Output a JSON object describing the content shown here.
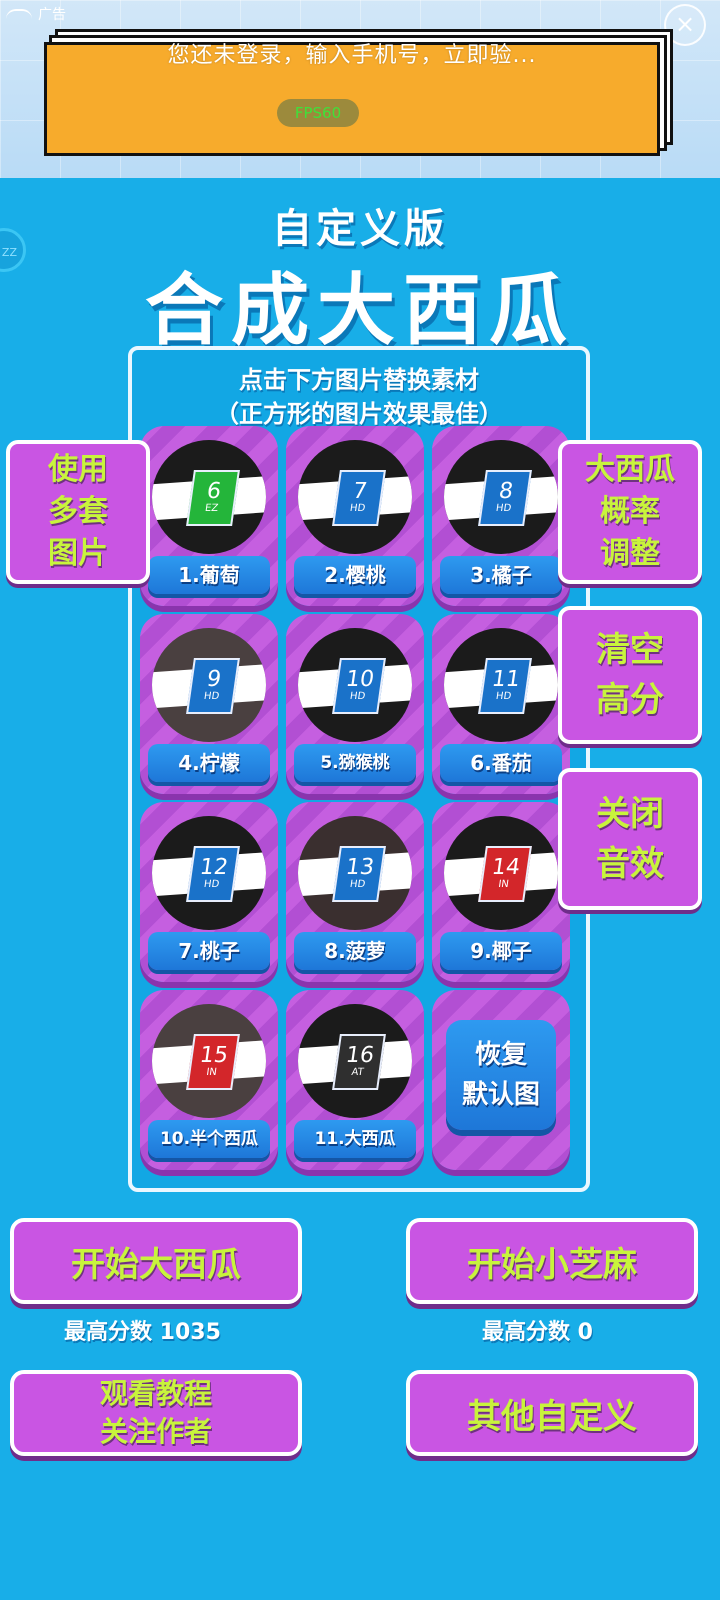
{
  "ad": {
    "label": "广告",
    "close_symbol": "×",
    "text": "您还未登录，输入手机号，立即验...",
    "fps": "FPS60"
  },
  "side_token": "ZZ",
  "header": {
    "subtitle": "自定义版",
    "title": "合成大西瓜"
  },
  "panel": {
    "line1": "点击下方图片替换素材",
    "line2": "（正方形的图片效果最佳）",
    "tiles": [
      {
        "number": "6",
        "sub": "EZ",
        "label": "1.葡萄"
      },
      {
        "number": "7",
        "sub": "HD",
        "label": "2.樱桃"
      },
      {
        "number": "8",
        "sub": "HD",
        "label": "3.橘子"
      },
      {
        "number": "9",
        "sub": "HD",
        "label": "4.柠檬"
      },
      {
        "number": "10",
        "sub": "HD",
        "label": "5.猕猴桃"
      },
      {
        "number": "11",
        "sub": "HD",
        "label": "6.番茄"
      },
      {
        "number": "12",
        "sub": "HD",
        "label": "7.桃子"
      },
      {
        "number": "13",
        "sub": "HD",
        "label": "8.菠萝"
      },
      {
        "number": "14",
        "sub": "IN",
        "label": "9.椰子"
      },
      {
        "number": "15",
        "sub": "IN",
        "label": "10.半个西瓜"
      },
      {
        "number": "16",
        "sub": "AT",
        "label": "11.大西瓜"
      }
    ],
    "restore": {
      "line1": "恢复",
      "line2": "默认图"
    }
  },
  "side_buttons": {
    "multi_images": {
      "line1": "使用",
      "line2": "多套",
      "line3": "图片"
    },
    "probability": {
      "line1": "大西瓜",
      "line2": "概率",
      "line3": "调整"
    },
    "clear_score": {
      "line1": "清空",
      "line2": "高分"
    },
    "mute": {
      "line1": "关闭",
      "line2": "音效"
    }
  },
  "bottom": {
    "start_big": "开始大西瓜",
    "start_small": "开始小芝麻",
    "best_big": "最高分数 1035",
    "best_small": "最高分数 0",
    "tutorial_line1": "观看教程",
    "tutorial_line2": "关注作者",
    "other": "其他自定义"
  },
  "colors": {
    "background": "#18aee8",
    "tile_purple": "#c55fe0",
    "label_blue": "#1e77d8",
    "button_text_lime": "#c8f43c",
    "card_green": "#24b53a",
    "card_blue": "#1a72c9",
    "card_red": "#d3262a",
    "card_dark": "#2f2f2f"
  }
}
